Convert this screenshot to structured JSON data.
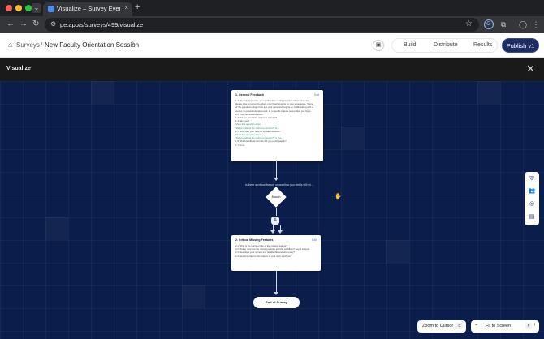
{
  "browser": {
    "tab_title": "Visualize – Survey Everywhere",
    "tab_close": "×",
    "new_tab": "+",
    "url": "pe.app/s/surveys/499/visualize"
  },
  "header": {
    "breadcrumb_root": "Surveys",
    "breadcrumb_sep": "/",
    "survey_title": "New Faculty Orientation Session",
    "tabs": [
      "Build",
      "Distribute",
      "Results"
    ],
    "publish_label": "Publish v1"
  },
  "visualize": {
    "title": "Visualize",
    "nodes": {
      "section1": {
        "title": "1. General Feedback",
        "edit": "Edit",
        "lines": [
          {
            "text": "1.1 We truly appreciate your participation in the program! As we close out,",
            "style": "q"
          },
          {
            "text": "please take a moment to share your final thoughts on your experience. Some",
            "style": "q"
          },
          {
            "text": "of the questions range from just your general thoughts on collaborating with a",
            "style": "q"
          },
          {
            "text": "vendor on product development, to a specific feature or workflow you hope...",
            "style": "q"
          },
          {
            "text": "1.2 Your role and institution",
            "style": "q"
          },
          {
            "text": "1.3 Did you attend the welcome session?",
            "style": "q"
          },
          {
            "text": "1.4 Day Logic",
            "style": "q"
          },
          {
            "text": "Show this question when:",
            "style": "g"
          },
          {
            "text": "\"Did you attend the welcome session?\" is",
            "style": "g"
          },
          {
            "text": "1.5 What was your favorite speaker session?",
            "style": "q"
          },
          {
            "text": "Show this question when:",
            "style": "g"
          },
          {
            "text": "\"Did you attend the welcome session?\" is Yes",
            "style": "g"
          },
          {
            "text": "1.6 Which feedback formats did you participate in?",
            "style": "q"
          },
          {
            "text": "1.7 Done",
            "style": "n"
          }
        ]
      },
      "condition_text": "Is there a critical feature or workflow you feel is still mi...",
      "branch_label": "Branch",
      "branch_badge": "A",
      "section2": {
        "title": "2. Critical Missing Features",
        "edit": "Edit",
        "lines": [
          {
            "text": "2.1 What is the name or title of the missing feature?",
            "style": "q"
          },
          {
            "text": "2.2 Please describe the missing feature and the workflow it would support.",
            "style": "q"
          },
          {
            "text": "2.3 How does your current tool handle this scenario today?",
            "style": "q"
          },
          {
            "text": "2.4 How important is this feature to your daily workflow?",
            "style": "q"
          }
        ]
      },
      "end_label": "End of Survey"
    },
    "controls": {
      "zoom_to_cursor": "Zoom to Cursor",
      "zoom_key": "C",
      "fit_minus": "–",
      "fit_to_screen": "Fit to Screen",
      "fit_key": "F",
      "fit_plus": "+"
    },
    "side_tools": [
      "shield-icon",
      "users-icon",
      "compass-icon",
      "image-icon"
    ]
  }
}
